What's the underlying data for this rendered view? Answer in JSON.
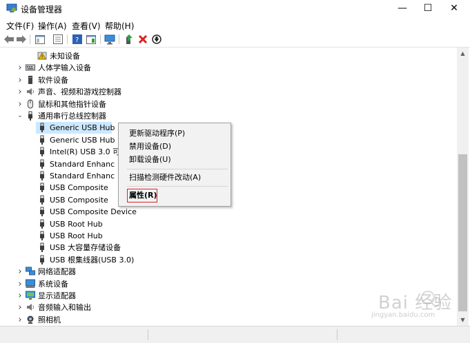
{
  "window": {
    "title": "设备管理器",
    "controls": {
      "minimize": "—",
      "maximize": "☐",
      "close": "✕"
    }
  },
  "menubar": {
    "items": [
      "文件(F)",
      "操作(A)",
      "查看(V)",
      "帮助(H)"
    ]
  },
  "toolbar": {
    "icons": [
      "back-icon",
      "forward-icon",
      "console-tree-icon",
      "properties-icon",
      "help-icon",
      "action-pane-icon",
      "monitor-icon",
      "update-driver-icon",
      "uninstall-icon",
      "enable-icon"
    ]
  },
  "tree": {
    "items": [
      {
        "label": "未知设备",
        "indent": 2,
        "icon": "unknown-device-icon",
        "expander": ""
      },
      {
        "label": "人体学输入设备",
        "indent": 1,
        "icon": "hid-icon",
        "expander": "›"
      },
      {
        "label": "软件设备",
        "indent": 1,
        "icon": "software-device-icon",
        "expander": "›"
      },
      {
        "label": "声音、视频和游戏控制器",
        "indent": 1,
        "icon": "speaker-icon",
        "expander": "›"
      },
      {
        "label": "鼠标和其他指针设备",
        "indent": 1,
        "icon": "mouse-icon",
        "expander": "›"
      },
      {
        "label": "通用串行总线控制器",
        "indent": 1,
        "icon": "usb-icon",
        "expander": "⌄"
      },
      {
        "label": "Generic USB Hub",
        "indent": 2,
        "icon": "usb-icon",
        "expander": "",
        "selected": true
      },
      {
        "label": "Generic USB Hub",
        "indent": 2,
        "icon": "usb-icon",
        "expander": ""
      },
      {
        "label": "Intel(R) USB 3.0 可",
        "indent": 2,
        "icon": "usb-icon",
        "expander": ""
      },
      {
        "label": "Standard Enhanc",
        "indent": 2,
        "icon": "usb-icon",
        "expander": ""
      },
      {
        "label": "Standard Enhanc",
        "indent": 2,
        "icon": "usb-icon",
        "expander": ""
      },
      {
        "label": "USB Composite",
        "indent": 2,
        "icon": "usb-icon",
        "expander": ""
      },
      {
        "label": "USB Composite",
        "indent": 2,
        "icon": "usb-icon",
        "expander": ""
      },
      {
        "label": "USB Composite Device",
        "indent": 2,
        "icon": "usb-icon",
        "expander": ""
      },
      {
        "label": "USB Root Hub",
        "indent": 2,
        "icon": "usb-icon",
        "expander": ""
      },
      {
        "label": "USB Root Hub",
        "indent": 2,
        "icon": "usb-icon",
        "expander": ""
      },
      {
        "label": "USB 大容量存储设备",
        "indent": 2,
        "icon": "usb-icon",
        "expander": ""
      },
      {
        "label": "USB 根集线器(USB 3.0)",
        "indent": 2,
        "icon": "usb-icon",
        "expander": ""
      },
      {
        "label": "网络适配器",
        "indent": 1,
        "icon": "network-icon",
        "expander": "›"
      },
      {
        "label": "系统设备",
        "indent": 1,
        "icon": "system-device-icon",
        "expander": "›"
      },
      {
        "label": "显示适配器",
        "indent": 1,
        "icon": "display-icon",
        "expander": "›"
      },
      {
        "label": "音频输入和输出",
        "indent": 1,
        "icon": "speaker-icon",
        "expander": "›"
      },
      {
        "label": "照相机",
        "indent": 1,
        "icon": "camera-icon",
        "expander": "›"
      }
    ]
  },
  "context_menu": {
    "items": [
      {
        "label": "更新驱动程序(P)"
      },
      {
        "label": "禁用设备(D)"
      },
      {
        "label": "卸载设备(U)"
      },
      {
        "label": "扫描检测硬件改动(A)"
      },
      {
        "label": "属性(R)",
        "bold": true,
        "highlighted": true
      }
    ]
  },
  "watermark": {
    "text": "Bai 经验",
    "sub": "jingyan.baidu.com"
  },
  "colors": {
    "selection": "#cce8ff",
    "highlight_box": "#e02020",
    "usb_icon": "#3c3c3c"
  }
}
